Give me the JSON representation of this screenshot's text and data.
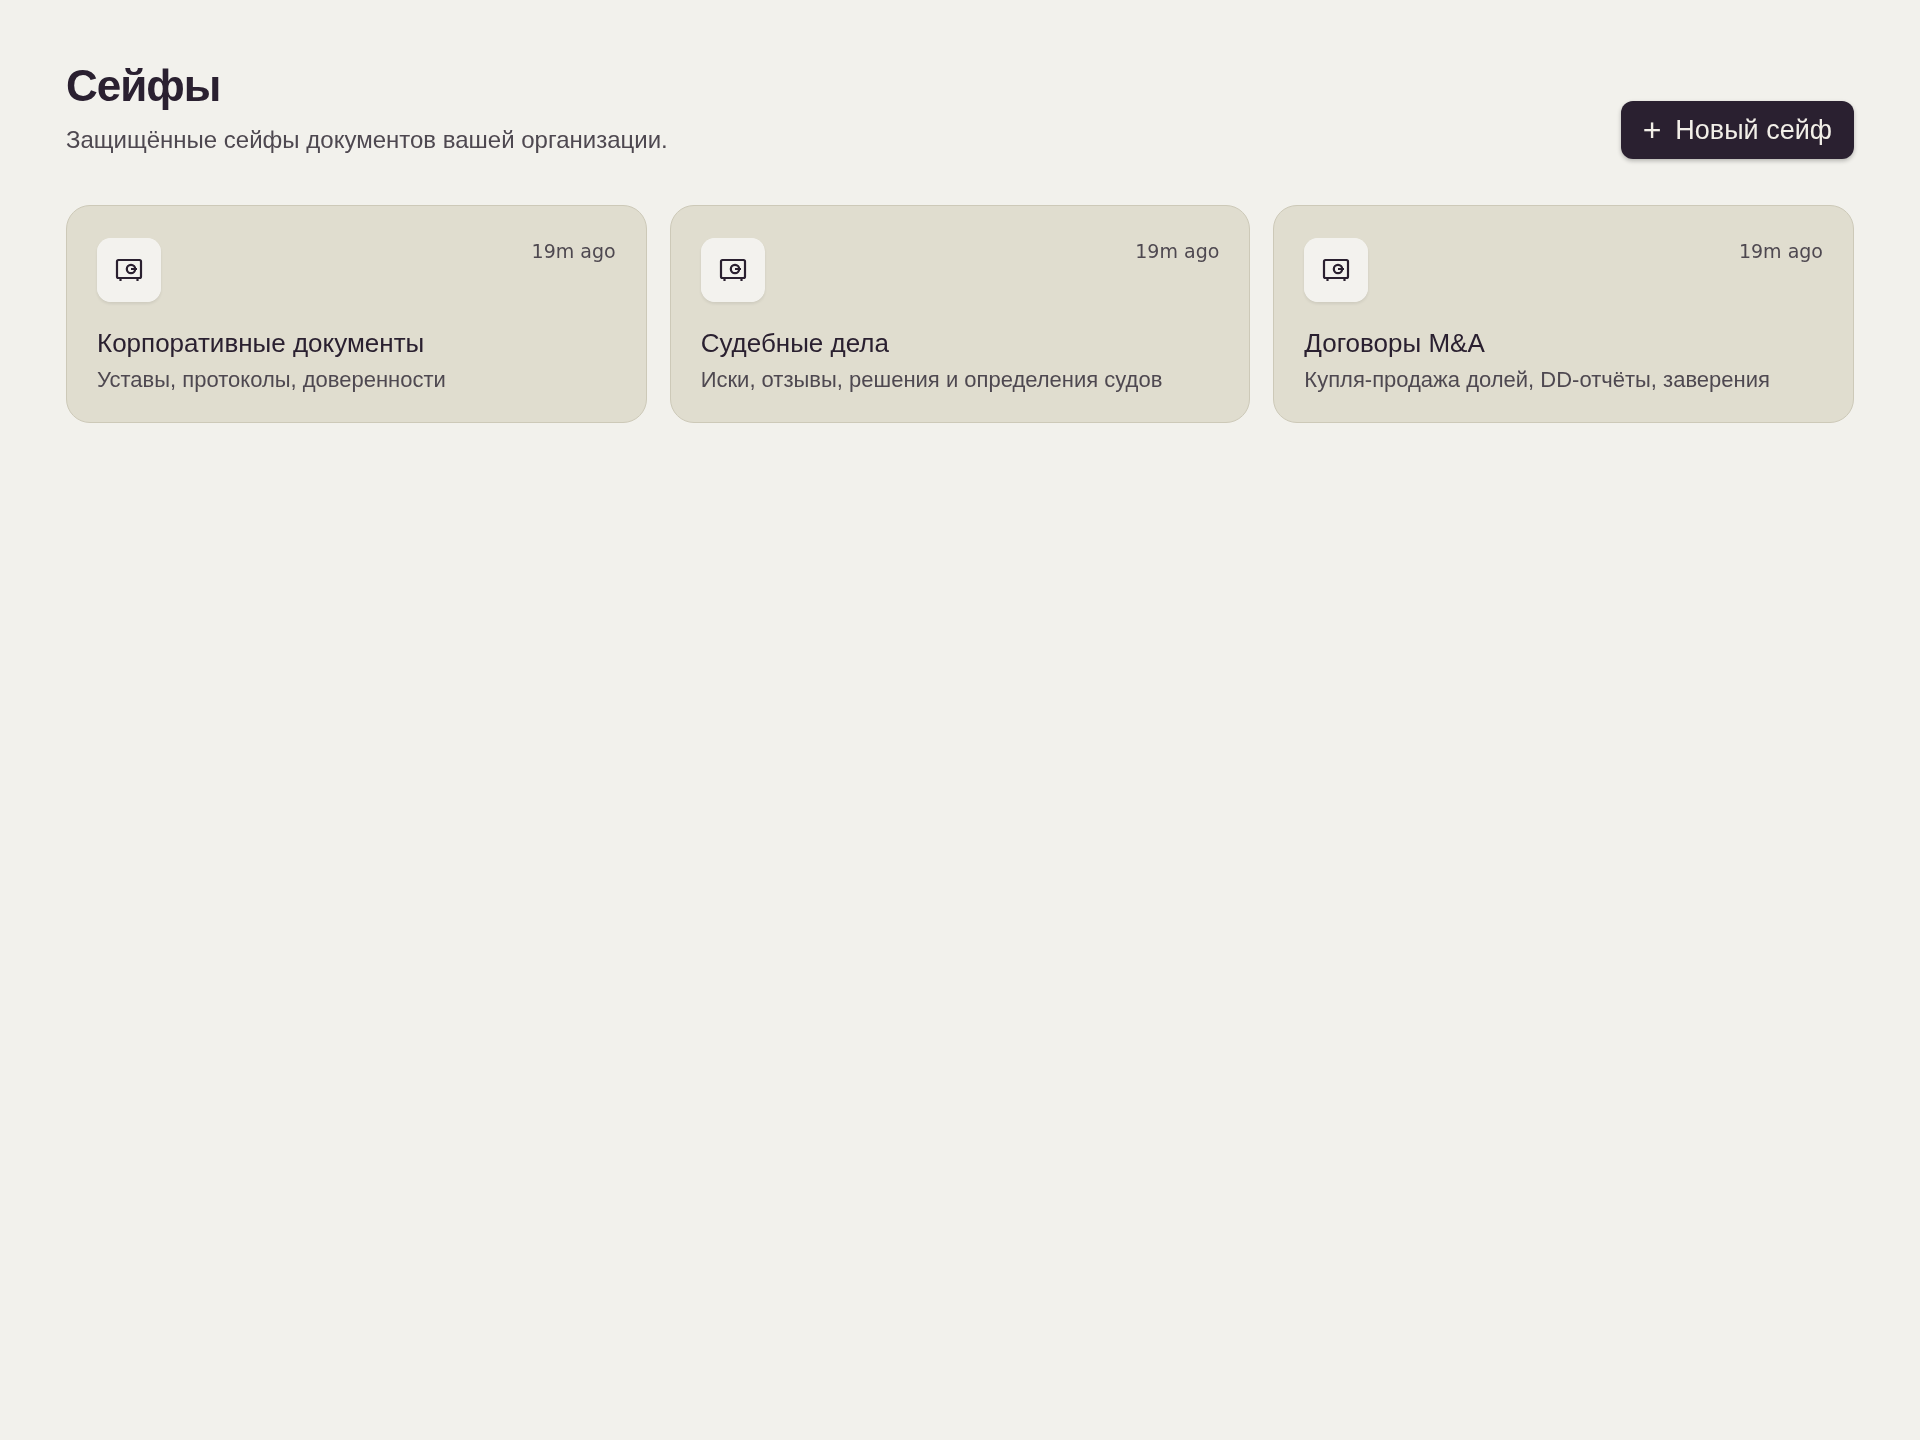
{
  "header": {
    "title": "Сейфы",
    "subtitle": "Защищённые сейфы документов вашей организации."
  },
  "new_button": {
    "icon": "+",
    "label": "Новый сейф"
  },
  "vaults": [
    {
      "name": "Корпоративные документы",
      "description": "Уставы, протоколы, доверенности",
      "updated": "19m ago"
    },
    {
      "name": "Судебные дела",
      "description": "Иски, отзывы, решения и определения судов",
      "updated": "19m ago"
    },
    {
      "name": "Договоры M&A",
      "description": "Купля-продажа долей, DD-отчёты, заверения",
      "updated": "19m ago"
    }
  ]
}
